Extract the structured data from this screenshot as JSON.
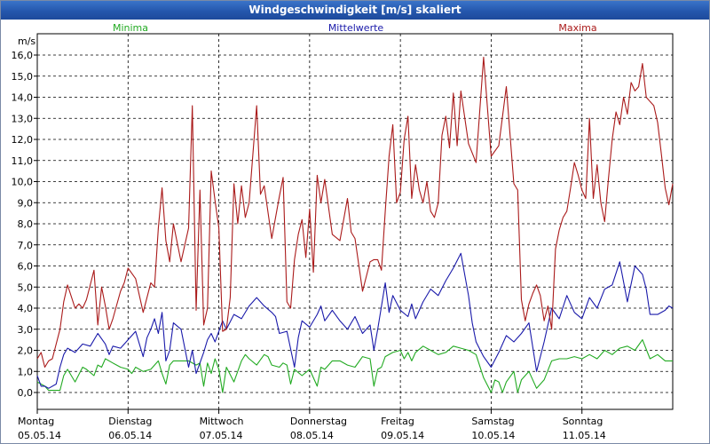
{
  "window": {
    "title": "Windgeschwindigkeit [m/s] skaliert"
  },
  "chart_data": {
    "type": "line",
    "title": "Windgeschwindigkeit [m/s] skaliert",
    "ylabel": "m/s",
    "ylim": [
      -0.3,
      16.5
    ],
    "yticks": [
      "0,0",
      "1,0",
      "2,0",
      "3,0",
      "4,0",
      "5,0",
      "6,0",
      "7,0",
      "8,0",
      "9,0",
      "10,0",
      "11,0",
      "12,0",
      "13,0",
      "14,0",
      "15,0",
      "16,0"
    ],
    "xlim": [
      0,
      168
    ],
    "x_days": [
      {
        "day": "Montag",
        "date": "05.05.14"
      },
      {
        "day": "Dienstag",
        "date": "06.05.14"
      },
      {
        "day": "Mittwoch",
        "date": "07.05.14"
      },
      {
        "day": "Donnerstag",
        "date": "08.05.14"
      },
      {
        "day": "Freitag",
        "date": "09.05.14"
      },
      {
        "day": "Samstag",
        "date": "10.05.14"
      },
      {
        "day": "Sonntag",
        "date": "11.05.14"
      }
    ],
    "grid": true,
    "legend_placement": "top",
    "series": [
      {
        "name": "Minima",
        "color": "#22aa22",
        "x": [
          0,
          2,
          3,
          4,
          6,
          7,
          8,
          10,
          12,
          13,
          15,
          16,
          17,
          18,
          20,
          22,
          24,
          25,
          26,
          28,
          30,
          32,
          33,
          34,
          35,
          36,
          38,
          40,
          42,
          43,
          44,
          45,
          46,
          47,
          48,
          49,
          50,
          52,
          54,
          55,
          56,
          58,
          60,
          61,
          62,
          64,
          65,
          66,
          67,
          68,
          70,
          72,
          74,
          75,
          76,
          78,
          80,
          82,
          84,
          86,
          88,
          89,
          90,
          91,
          92,
          94,
          96,
          97,
          98,
          99,
          100,
          102,
          104,
          106,
          108,
          110,
          112,
          114,
          116,
          118,
          120,
          121,
          122,
          123,
          124,
          126,
          127,
          128,
          130,
          132,
          134,
          136,
          138,
          140,
          142,
          144,
          146,
          148,
          150,
          152,
          154,
          156,
          158,
          160,
          162,
          164,
          166,
          168
        ],
        "y": [
          0.5,
          0.3,
          0.1,
          0.1,
          0.1,
          0.8,
          1.1,
          0.5,
          1.2,
          1.1,
          0.8,
          1.3,
          1.2,
          1.6,
          1.4,
          1.2,
          1.1,
          0.9,
          1.2,
          1.0,
          1.1,
          1.5,
          0.9,
          0.4,
          1.3,
          1.5,
          1.5,
          1.5,
          1.3,
          1.4,
          0.3,
          1.4,
          0.9,
          1.6,
          1.1,
          0.0,
          1.2,
          0.5,
          1.5,
          1.8,
          1.6,
          1.3,
          1.8,
          1.7,
          1.3,
          1.2,
          1.4,
          1.3,
          0.4,
          1.1,
          0.8,
          1.1,
          0.3,
          1.2,
          1.1,
          1.5,
          1.5,
          1.3,
          1.2,
          1.7,
          1.6,
          0.3,
          1.1,
          1.2,
          1.7,
          1.9,
          2.0,
          1.6,
          1.9,
          1.5,
          1.9,
          2.2,
          2.0,
          1.8,
          1.9,
          2.2,
          2.1,
          2.0,
          1.8,
          0.7,
          0.0,
          0.6,
          0.5,
          0.0,
          0.5,
          1.0,
          0.0,
          0.6,
          1.0,
          0.2,
          0.6,
          1.5,
          1.6,
          1.6,
          1.7,
          1.6,
          1.8,
          1.6,
          2.0,
          1.8,
          2.1,
          2.2,
          2.0,
          2.5,
          1.6,
          1.8,
          1.5,
          1.5
        ]
      },
      {
        "name": "Mittelwerte",
        "color": "#1a1aaa",
        "x": [
          0,
          1,
          2,
          3,
          5,
          6,
          7,
          8,
          10,
          12,
          14,
          16,
          18,
          19,
          20,
          22,
          24,
          26,
          28,
          29,
          30,
          31,
          32,
          33,
          34,
          35,
          36,
          38,
          40,
          41,
          42,
          44,
          45,
          46,
          47,
          48,
          49,
          50,
          52,
          54,
          56,
          58,
          60,
          62,
          63,
          64,
          66,
          68,
          69,
          70,
          72,
          74,
          75,
          76,
          78,
          80,
          82,
          84,
          86,
          88,
          89,
          90,
          92,
          93,
          94,
          96,
          98,
          99,
          100,
          102,
          104,
          106,
          108,
          110,
          112,
          114,
          115,
          116,
          118,
          120,
          122,
          124,
          126,
          128,
          130,
          132,
          134,
          136,
          138,
          140,
          142,
          144,
          146,
          148,
          150,
          152,
          154,
          156,
          158,
          160,
          161,
          162,
          164,
          166,
          167,
          168
        ],
        "y": [
          0.8,
          0.3,
          0.3,
          0.2,
          0.4,
          1.2,
          1.8,
          2.1,
          1.9,
          2.3,
          2.2,
          2.8,
          2.3,
          1.8,
          2.2,
          2.1,
          2.5,
          2.9,
          1.7,
          2.6,
          3.0,
          3.5,
          2.8,
          3.8,
          1.5,
          2.0,
          3.3,
          3.0,
          1.2,
          2.0,
          0.9,
          1.9,
          2.5,
          2.8,
          2.4,
          2.9,
          3.4,
          3.0,
          3.7,
          3.5,
          4.1,
          4.5,
          4.1,
          3.8,
          3.6,
          2.8,
          2.9,
          1.2,
          2.6,
          3.4,
          3.1,
          3.7,
          4.1,
          3.4,
          3.9,
          3.4,
          3.0,
          3.6,
          2.8,
          3.2,
          2.0,
          3.0,
          5.2,
          3.8,
          4.6,
          3.9,
          3.6,
          4.2,
          3.5,
          4.3,
          4.9,
          4.6,
          5.3,
          5.9,
          6.6,
          4.6,
          3.3,
          2.4,
          1.7,
          1.2,
          1.9,
          2.7,
          2.4,
          2.8,
          3.3,
          1.0,
          2.4,
          4.0,
          3.5,
          4.6,
          3.8,
          3.5,
          4.5,
          4.0,
          4.9,
          5.1,
          6.2,
          4.3,
          6.0,
          5.6,
          4.9,
          3.7,
          3.7,
          3.9,
          4.1,
          4.0
        ]
      },
      {
        "name": "Maxima",
        "color": "#aa1a1a",
        "x": [
          0,
          1,
          2,
          3,
          4,
          6,
          7,
          8,
          10,
          11,
          12,
          13,
          14,
          15,
          16,
          17,
          18,
          19,
          20,
          22,
          23,
          24,
          26,
          28,
          30,
          31,
          32,
          33,
          34,
          35,
          36,
          38,
          40,
          41,
          42,
          43,
          44,
          45,
          46,
          47,
          48,
          49,
          50,
          51,
          52,
          53,
          54,
          55,
          56,
          58,
          59,
          60,
          62,
          64,
          65,
          66,
          67,
          68,
          69,
          70,
          71,
          72,
          73,
          74,
          75,
          76,
          78,
          80,
          82,
          83,
          84,
          86,
          88,
          89,
          90,
          91,
          92,
          93,
          94,
          95,
          96,
          97,
          98,
          99,
          100,
          101,
          102,
          103,
          104,
          105,
          106,
          107,
          108,
          109,
          110,
          111,
          112,
          114,
          116,
          118,
          120,
          122,
          124,
          126,
          127,
          128,
          129,
          130,
          131,
          132,
          133,
          134,
          135,
          136,
          137,
          138,
          139,
          140,
          141,
          142,
          143,
          144,
          145,
          146,
          147,
          148,
          149,
          150,
          151,
          152,
          153,
          154,
          155,
          156,
          157,
          158,
          159,
          160,
          161,
          162,
          163,
          164,
          165,
          166,
          167,
          168
        ],
        "y": [
          1.6,
          1.9,
          1.2,
          1.5,
          1.6,
          3.0,
          4.3,
          5.1,
          4.0,
          4.2,
          4.0,
          4.4,
          5.1,
          5.8,
          3.2,
          5.0,
          4.1,
          3.0,
          3.5,
          4.8,
          5.2,
          5.9,
          5.4,
          3.8,
          5.2,
          5.0,
          7.8,
          9.7,
          7.2,
          6.2,
          8.0,
          6.2,
          7.8,
          13.6,
          3.9,
          9.6,
          3.2,
          4.0,
          10.5,
          9.1,
          7.8,
          2.9,
          3.0,
          4.5,
          9.9,
          8.0,
          9.8,
          8.3,
          9.0,
          13.6,
          9.4,
          9.8,
          7.3,
          9.3,
          10.2,
          4.3,
          4.0,
          6.3,
          7.5,
          8.2,
          6.4,
          8.7,
          5.7,
          10.3,
          9.0,
          10.1,
          7.5,
          7.2,
          9.2,
          7.6,
          7.3,
          4.8,
          6.2,
          6.3,
          6.3,
          5.8,
          8.6,
          11.2,
          12.7,
          9.0,
          9.5,
          12.0,
          13.1,
          9.2,
          10.8,
          9.6,
          9.0,
          10.0,
          8.6,
          8.3,
          9.0,
          12.2,
          13.1,
          11.6,
          14.2,
          11.7,
          14.3,
          11.8,
          10.9,
          15.9,
          11.2,
          11.7,
          14.5,
          9.9,
          9.6,
          4.4,
          3.4,
          4.2,
          4.7,
          5.1,
          4.6,
          3.4,
          4.1,
          3.0,
          6.8,
          7.7,
          8.3,
          8.6,
          9.7,
          10.9,
          10.3,
          9.6,
          9.2,
          13.0,
          9.2,
          10.8,
          9.0,
          8.1,
          10.1,
          12.0,
          13.3,
          12.7,
          14.0,
          13.2,
          14.7,
          14.3,
          14.5,
          15.6,
          14.0,
          13.8,
          13.6,
          12.8,
          11.3,
          9.7,
          8.9,
          9.9
        ]
      }
    ]
  }
}
